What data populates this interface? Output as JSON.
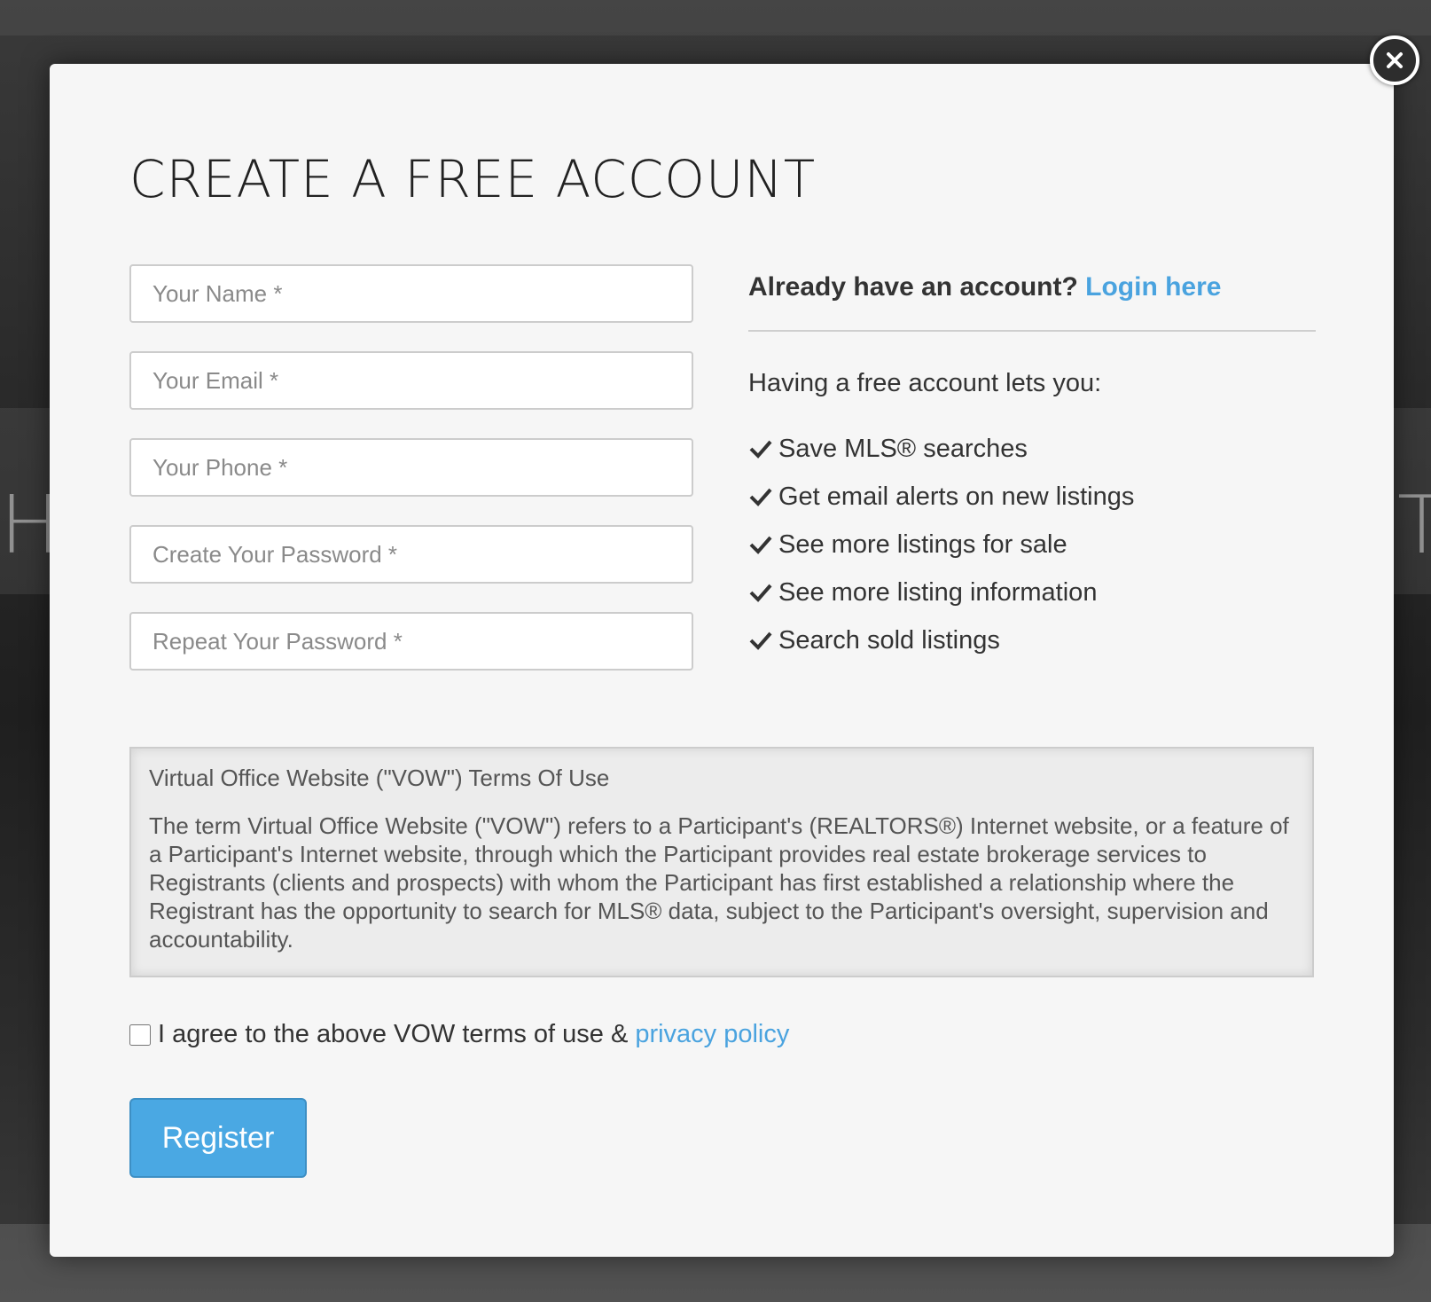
{
  "modal": {
    "title": "CREATE A FREE ACCOUNT",
    "close_icon": "close-icon"
  },
  "form": {
    "name_placeholder": "Your Name *",
    "email_placeholder": "Your Email *",
    "phone_placeholder": "Your Phone *",
    "password_placeholder": "Create Your Password *",
    "repeat_password_placeholder": "Repeat Your Password *"
  },
  "login": {
    "prompt": "Already have an account?",
    "link_label": "Login here"
  },
  "benefits": {
    "intro": "Having a free account lets you:",
    "items": [
      {
        "label": "Save MLS® searches"
      },
      {
        "label": "Get email alerts on new listings"
      },
      {
        "label": "See more listings for sale"
      },
      {
        "label": "See more listing information"
      },
      {
        "label": "Search sold listings"
      }
    ]
  },
  "terms": {
    "title": "Virtual Office Website (\"VOW\") Terms Of Use",
    "body": "The term Virtual Office Website (\"VOW\") refers to a Participant's (REALTORS®) Internet website, or a feature of a Participant's Internet website, through which the Participant provides real estate brokerage services to Registrants (clients and prospects) with whom the Participant has first established a relationship where the Registrant has the opportunity to search for MLS® data, subject to the Participant's oversight, supervision and accountability."
  },
  "agreement": {
    "label": "I agree to the above VOW terms of use &",
    "privacy_link": "privacy policy",
    "checked": false
  },
  "register_button": "Register",
  "colors": {
    "accent": "#4aa3df",
    "button": "#4aa8e3",
    "modal_bg": "#f6f6f6"
  }
}
